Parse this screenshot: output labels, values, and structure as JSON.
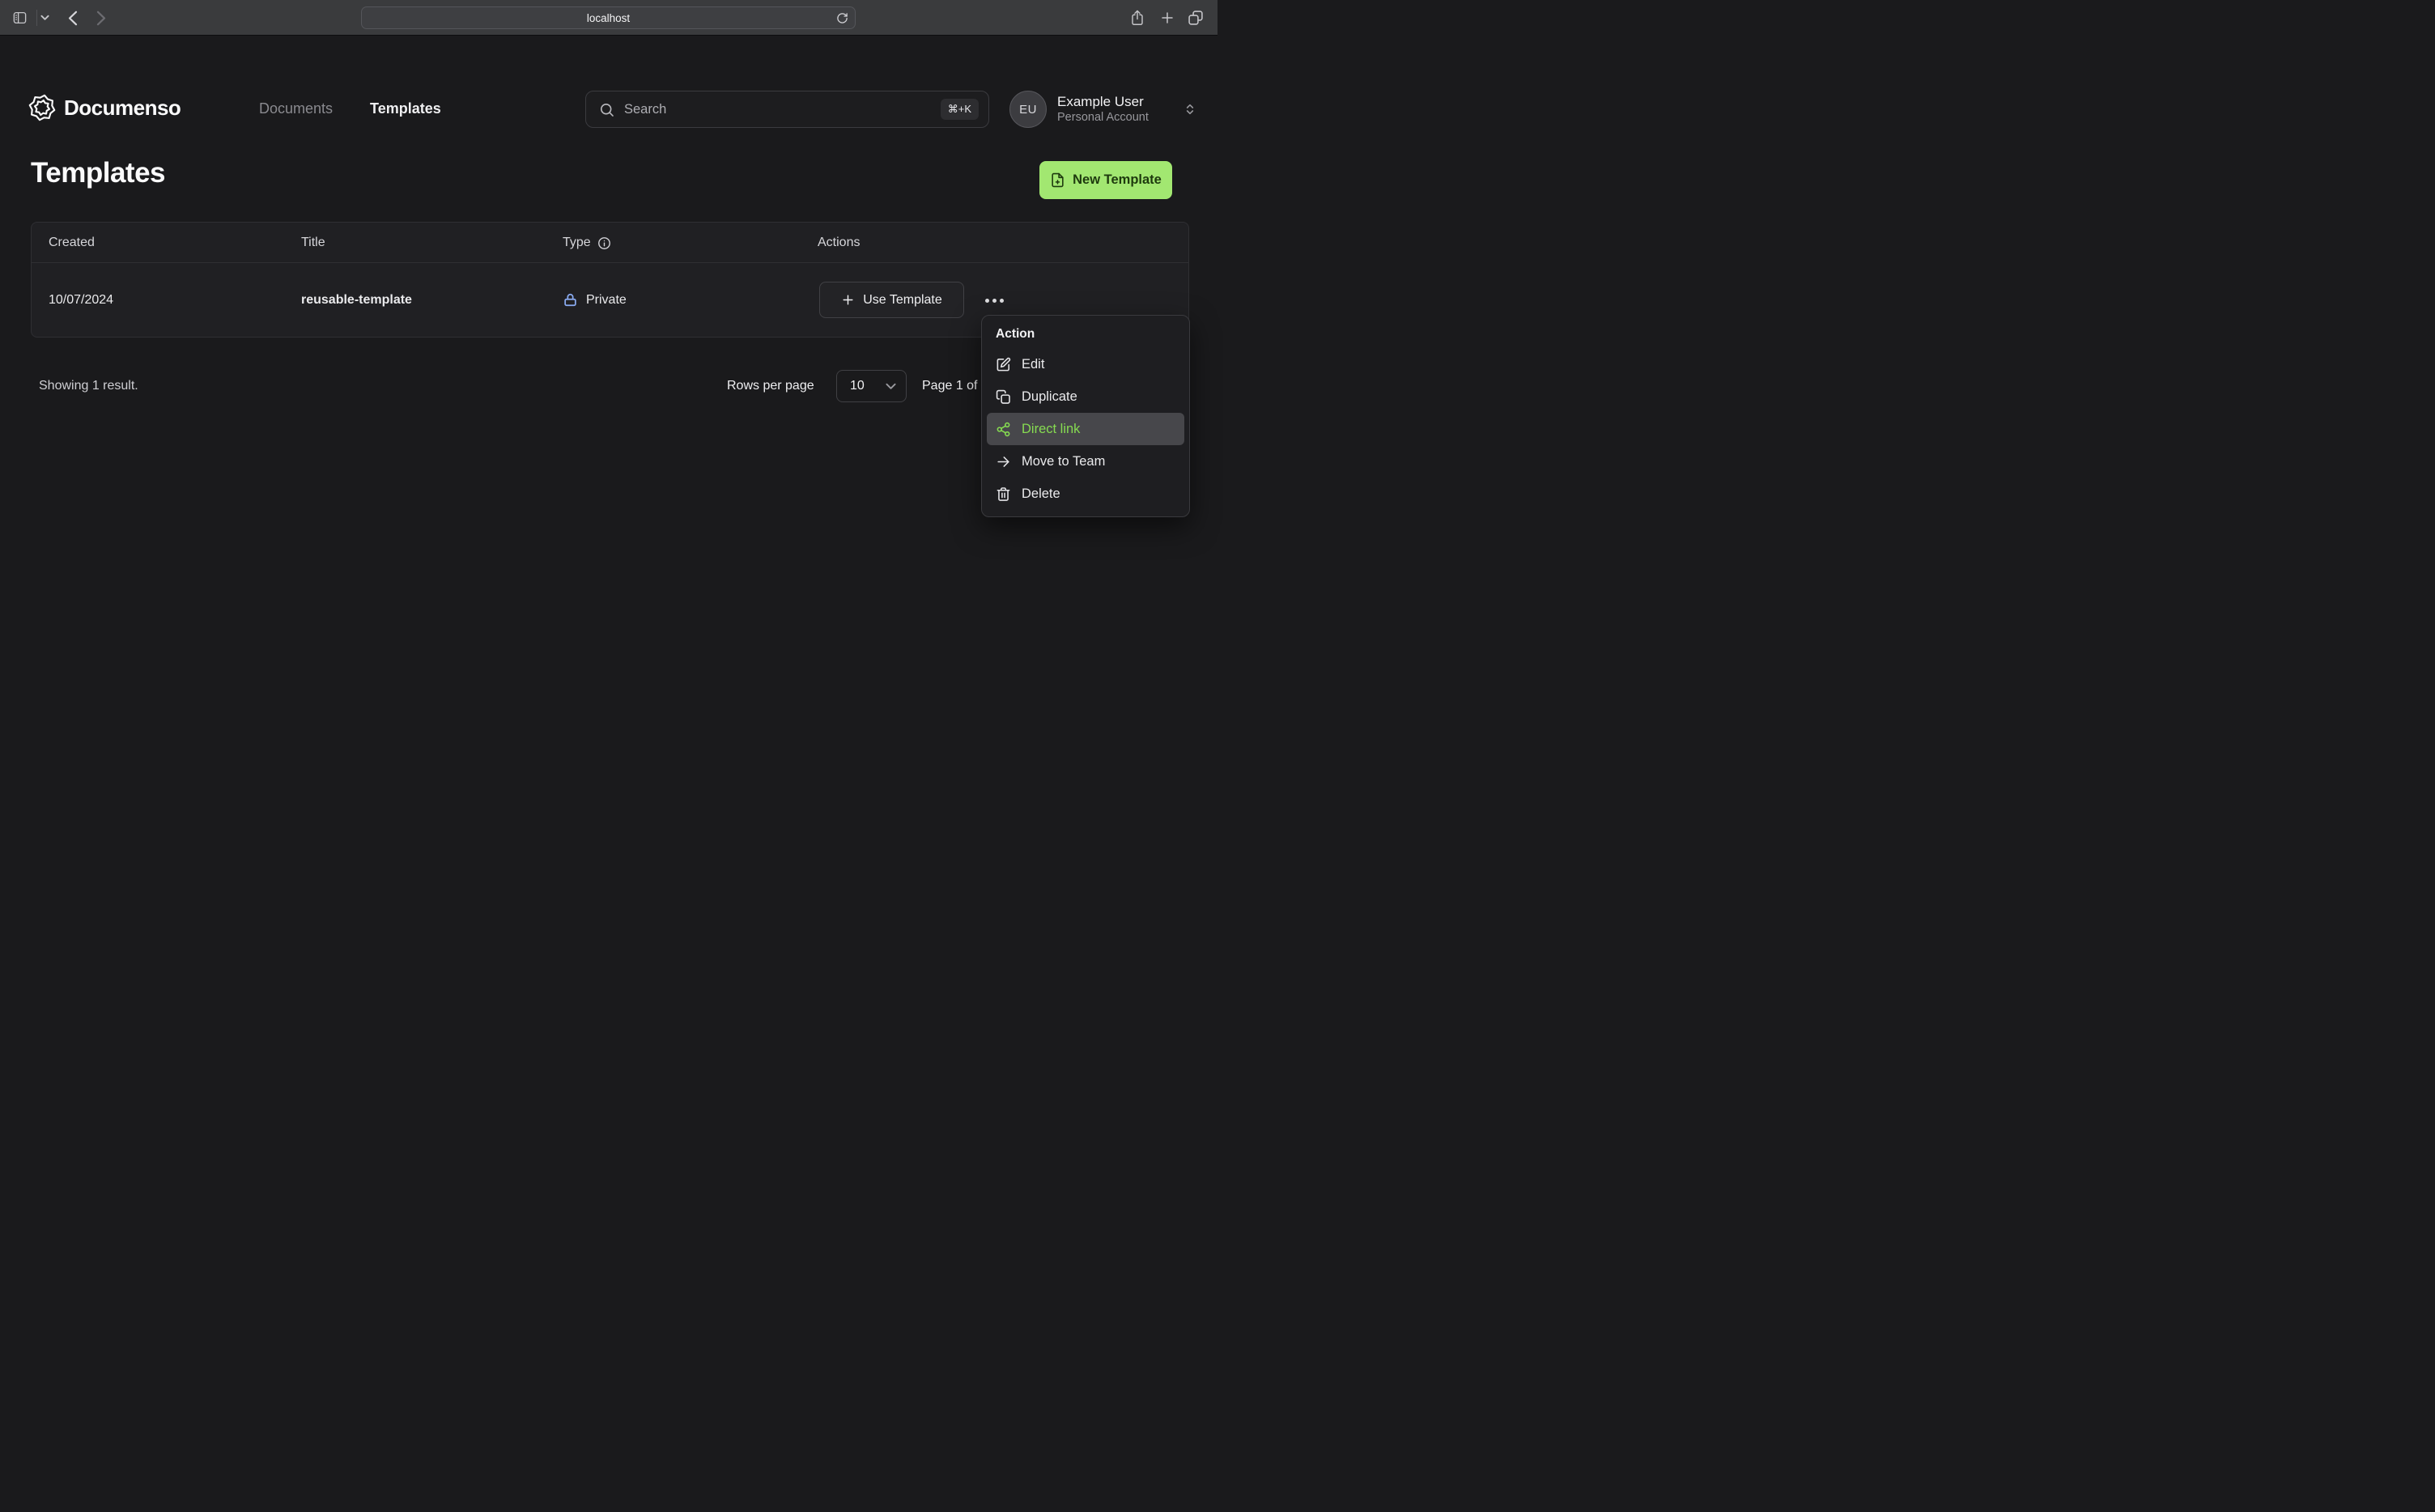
{
  "browser": {
    "url": "localhost"
  },
  "app_header": {
    "brand": "Documenso",
    "nav": [
      {
        "label": "Documents",
        "active": false
      },
      {
        "label": "Templates",
        "active": true
      }
    ],
    "search": {
      "placeholder": "Search",
      "shortcut": "⌘+K"
    },
    "user": {
      "initials": "EU",
      "name": "Example User",
      "account_type": "Personal Account"
    }
  },
  "page": {
    "title": "Templates",
    "new_template_button": "New Template"
  },
  "table": {
    "headers": {
      "created": "Created",
      "title": "Title",
      "type": "Type",
      "actions": "Actions"
    },
    "rows": [
      {
        "created": "10/07/2024",
        "title": "reusable-template",
        "type": "Private",
        "action_button": "Use Template"
      }
    ]
  },
  "footer": {
    "results_text": "Showing 1 result.",
    "rows_per_page_label": "Rows per page",
    "rows_per_page_value": "10",
    "page_text": "Page 1 of 1"
  },
  "context_menu": {
    "title": "Action",
    "items": [
      {
        "label": "Edit",
        "icon": "square-pen-icon",
        "highlighted": false
      },
      {
        "label": "Duplicate",
        "icon": "copy-icon",
        "highlighted": false
      },
      {
        "label": "Direct link",
        "icon": "share-link-icon",
        "highlighted": true
      },
      {
        "label": "Move to Team",
        "icon": "arrow-right-icon",
        "highlighted": false
      },
      {
        "label": "Delete",
        "icon": "trash-icon",
        "highlighted": false
      }
    ]
  },
  "colors": {
    "accent_green": "#A2E771",
    "accent_green_text": "#1E3A0E",
    "menu_link_green": "#86DB51",
    "lock_blue": "#8AABF2",
    "page_background": "#1A1A1C",
    "chrome_background": "#3A3B3D"
  }
}
